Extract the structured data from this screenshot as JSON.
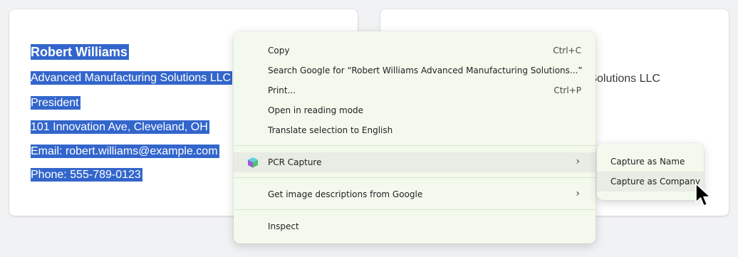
{
  "contact": {
    "name": "Robert Williams",
    "company": "Advanced Manufacturing Solutions LLC",
    "title": "President",
    "address": "101 Innovation Ave, Cleveland, OH",
    "email": "Email: robert.williams@example.com",
    "phone": "Phone: 555-789-0123"
  },
  "right_card": {
    "visible_text": "g Solutions LLC"
  },
  "context_menu": {
    "copy": {
      "label": "Copy",
      "shortcut": "Ctrl+C"
    },
    "search": {
      "label": "Search Google for “Robert Williams Advanced Manufacturing Solutions...”"
    },
    "print": {
      "label": "Print...",
      "shortcut": "Ctrl+P"
    },
    "reading_mode": {
      "label": "Open in reading mode"
    },
    "translate": {
      "label": "Translate selection to English"
    },
    "pcr_capture": {
      "label": "PCR Capture",
      "icon": "cube-icon"
    },
    "image_descriptions": {
      "label": "Get image descriptions from Google"
    },
    "inspect": {
      "label": "Inspect"
    }
  },
  "submenu": {
    "capture_name": "Capture as Name",
    "capture_company": "Capture as Company"
  },
  "colors": {
    "selection": "#3366cc",
    "menu_bg": "#f4f9ee",
    "hover_bg": "#e8ece4"
  }
}
